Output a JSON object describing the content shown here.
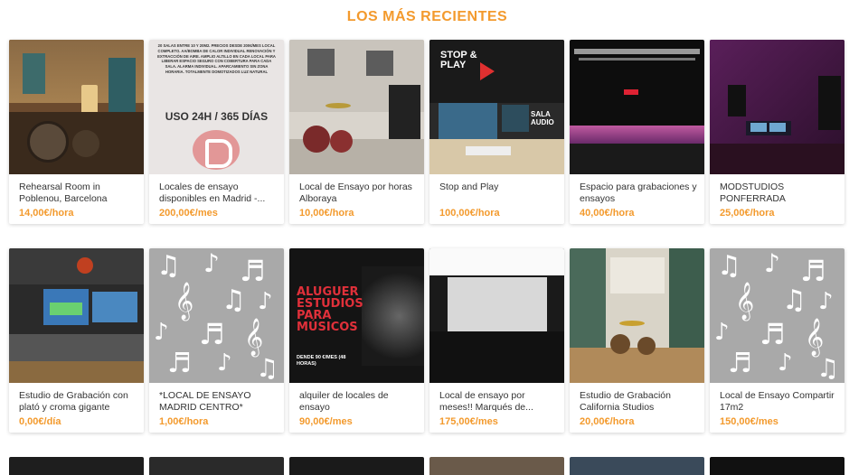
{
  "section": {
    "title": "LOS MÁS RECIENTES"
  },
  "row1": [
    {
      "title": "Rehearsal Room in Poblenou, Barcelona",
      "price": "14,00€/hora"
    },
    {
      "title": "Locales de ensayo disponibles en Madrid -...",
      "price": "200,00€/mes"
    },
    {
      "title": "Local de Ensayo por horas Alboraya",
      "price": "10,00€/hora"
    },
    {
      "title": "Stop and Play",
      "price": "100,00€/hora"
    },
    {
      "title": "Espacio para grabaciones y ensayos",
      "price": "40,00€/hora"
    },
    {
      "title": "MODSTUDIOS PONFERRADA",
      "price": "25,00€/hora"
    }
  ],
  "row2": [
    {
      "title": "Estudio de Grabación con plató y croma gigante",
      "price": "0,00€/día"
    },
    {
      "title": "*LOCAL DE ENSAYO MADRID CENTRO*",
      "price": "1,00€/hora"
    },
    {
      "title": "alquiler de locales de ensayo",
      "price": "90,00€/mes"
    },
    {
      "title": "Local de ensayo por meses!! Marqués de...",
      "price": "175,00€/mes"
    },
    {
      "title": "Estudio de Grabación California Studios",
      "price": "20,00€/hora"
    },
    {
      "title": "Local de Ensayo Compartir 17m2",
      "price": "150,00€/mes"
    }
  ],
  "thumbs": {
    "madrid_text": "20 SALAS ENTRE 10 Y 20M2. PRECIOS DESDE 200€/MES LOCAL COMPLETO. AA/BOMBA DE CALOR INDIVIDUAL RENOVACIÓN Y EXTRACCIÓN DE AIRE. AMPLIO ALTILLO EN CADA LOCAL PARA LIBERAR ESPACIO SEGURO CON COBERTURA PARA CADA SALA. ALARMA INDIVIDUAL. APARCAMIENTO SIN ZONA HORARIA. TOTALMENTE DOMOTIZADOS LUZ NATURAL",
    "madrid_big": "USO 24H / 365 DÍAS",
    "stop_logo": "STOP & PLAY",
    "sala_text": "SALA AUDIO",
    "aluguer_big": "ALUGUER ESTUDIOS PARA MÚSICOS",
    "aluguer_small": "DENDE 90 €/MES (48 HORAS)"
  },
  "colors": {
    "accent": "#f39a2d",
    "card_bg": "#ffffff",
    "text": "#333333"
  }
}
